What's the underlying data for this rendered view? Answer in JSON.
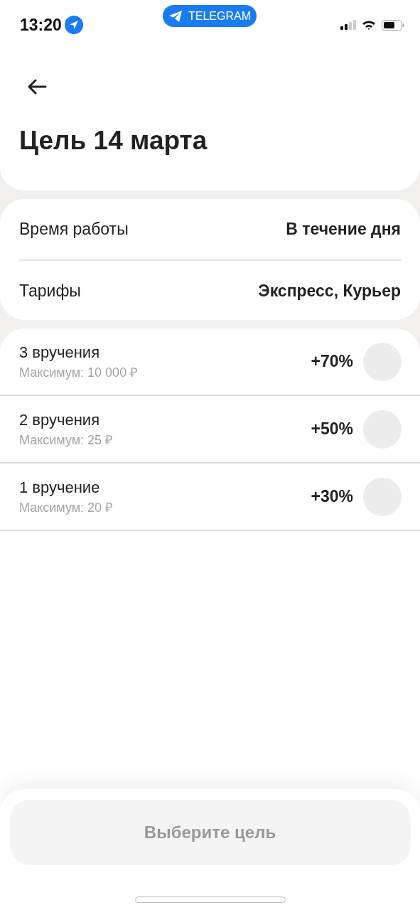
{
  "status_bar": {
    "time": "13:20",
    "badge": "TELEGRAM"
  },
  "title": "Цель 14 марта",
  "info": [
    {
      "label": "Время работы",
      "value": "В течение дня"
    },
    {
      "label": "Тарифы",
      "value": "Экспресс, Курьер"
    }
  ],
  "goals": [
    {
      "title": "3 вручения",
      "subtitle": "Максимум: 10 000 ₽",
      "bonus": "+70%",
      "selected": false
    },
    {
      "title": "2 вручения",
      "subtitle": "Максимум: 25 ₽",
      "bonus": "+50%",
      "selected": false
    },
    {
      "title": "1 вручение",
      "subtitle": "Максимум: 20 ₽",
      "bonus": "+30%",
      "selected": false
    }
  ],
  "button": {
    "label": "Выберите цель",
    "disabled": true
  }
}
